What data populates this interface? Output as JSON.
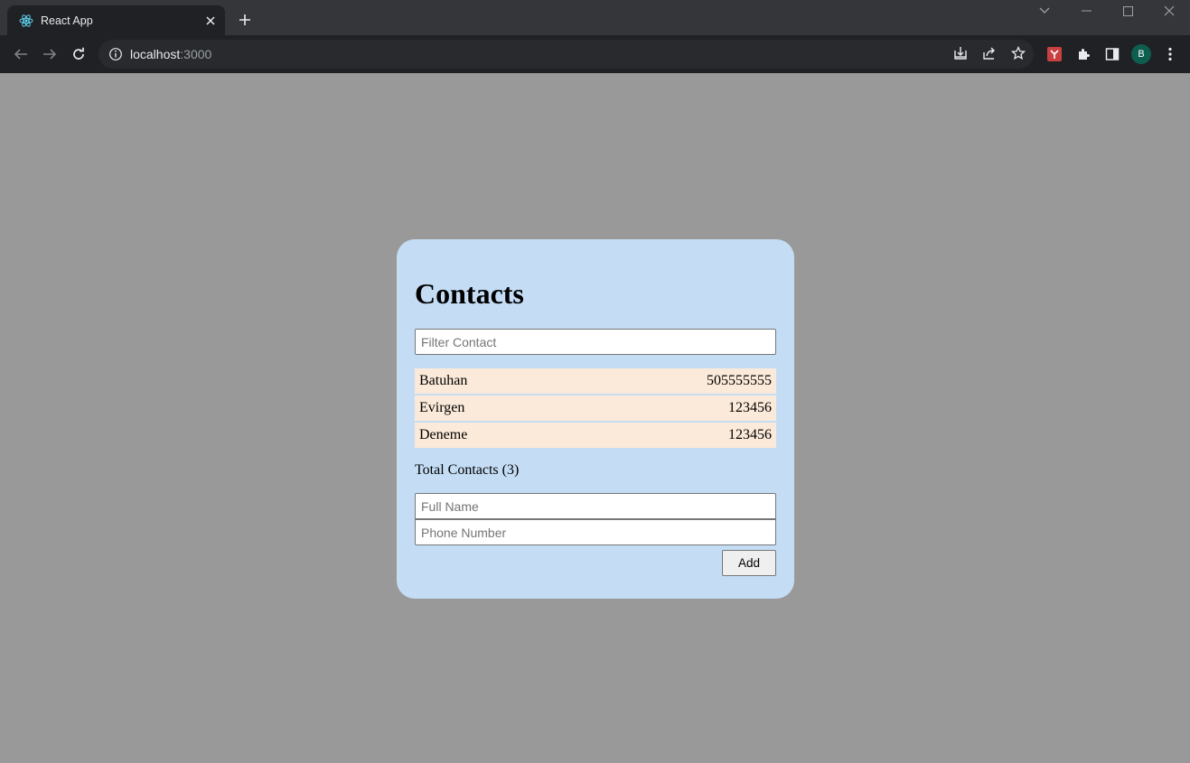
{
  "browser": {
    "tab_title": "React App",
    "url_host": "localhost",
    "url_port": ":3000",
    "avatar_initial": "B"
  },
  "page": {
    "heading": "Contacts",
    "filter_placeholder": "Filter Contact",
    "contacts": [
      {
        "name": "Batuhan",
        "phone": "505555555"
      },
      {
        "name": "Evirgen",
        "phone": "123456"
      },
      {
        "name": "Deneme",
        "phone": "123456"
      }
    ],
    "total_label": "Total Contacts (3)",
    "fullname_placeholder": "Full Name",
    "phone_placeholder": "Phone Number",
    "add_label": "Add"
  },
  "colors": {
    "page_background": "#999999",
    "card_background": "#c4ddf5",
    "row_background": "#fbead9",
    "browser_frame": "#35363a",
    "browser_toolbar": "#202124"
  }
}
